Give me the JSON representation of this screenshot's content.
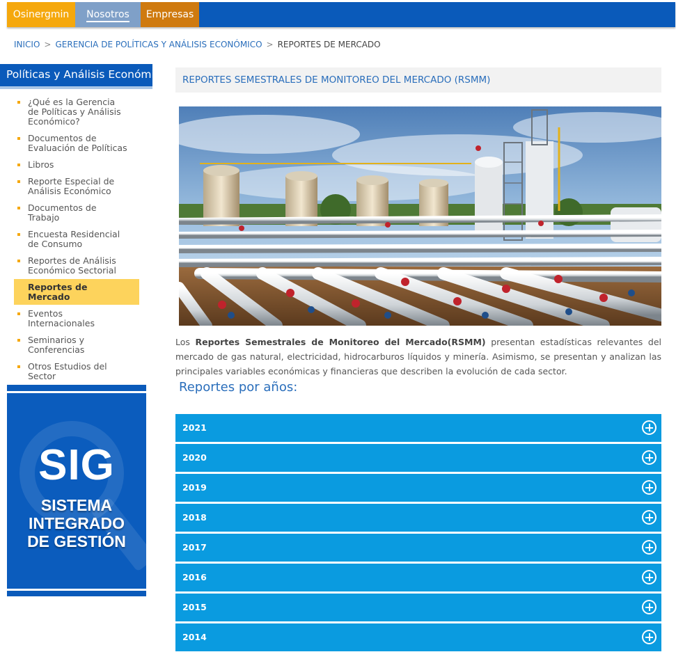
{
  "topnav": {
    "tabs": [
      "Osinergmin",
      "Nosotros",
      "Empresas"
    ],
    "colors": {
      "osinergmin": "#f5a80d",
      "nosotros": "#7fa0c8",
      "empresas": "#cf7a0f",
      "bar": "#0a5aba"
    }
  },
  "breadcrumb": {
    "items": [
      "INICIO",
      "GERENCIA DE POLÍTICAS Y ANÁLISIS ECONÓMICO",
      "REPORTES DE MERCADO"
    ],
    "separator": ">"
  },
  "sidebar": {
    "title": "Políticas y Análisis Económico",
    "items": [
      {
        "label": "¿Qué es la Gerencia de Políticas y Análisis Económico?",
        "lines": [
          "¿Qué es la Gerencia",
          "de Políticas y Análisis",
          "Económico?"
        ]
      },
      {
        "label": "Documentos de Evaluación de Políticas",
        "lines": [
          "Documentos de",
          "Evaluación de Políticas"
        ]
      },
      {
        "label": "Libros",
        "lines": [
          "Libros"
        ]
      },
      {
        "label": "Reporte Especial de Análisis Económico",
        "lines": [
          "Reporte Especial de",
          "Análisis Económico"
        ]
      },
      {
        "label": "Documentos de Trabajo",
        "lines": [
          "Documentos de",
          "Trabajo"
        ]
      },
      {
        "label": "Encuesta Residencial de Consumo",
        "lines": [
          "Encuesta Residencial",
          "de Consumo"
        ]
      },
      {
        "label": "Reportes de Análisis Económico Sectorial",
        "lines": [
          "Reportes de Análisis",
          "Económico Sectorial"
        ]
      },
      {
        "label": "Reportes de Mercado",
        "lines": [
          "Reportes de",
          "Mercado"
        ],
        "active": true
      },
      {
        "label": "Eventos Internacionales",
        "lines": [
          "Eventos",
          "Internacionales"
        ]
      },
      {
        "label": "Seminarios y Conferencias",
        "lines": [
          "Seminarios y",
          "Conferencias"
        ]
      },
      {
        "label": "Otros Estudios del Sector",
        "lines": [
          "Otros Estudios del",
          "Sector"
        ]
      }
    ],
    "banner": {
      "big": "SIG",
      "lines": [
        "SISTEMA",
        "INTEGRADO",
        "DE GESTIÓN"
      ]
    }
  },
  "main": {
    "header": "REPORTES SEMESTRALES DE MONITOREO DEL MERCADO (RSMM)",
    "hero_image": "industrial-gas-pipeline-photo",
    "desc_prefix": "Los ",
    "desc_bold": "Reportes Semestrales de Monitoreo del Mercado(RSMM)",
    "desc_rest": " presentan estadísticas relevantes del mercado de gas natural, electricidad, hidrocarburos líquidos y minería. Asimismo, se presentan y analizan las principales variables económicas y financieras que describen la evolución de cada sector.",
    "years_title": "Reportes por años:",
    "years": [
      "2021",
      "2020",
      "2019",
      "2018",
      "2017",
      "2016",
      "2015",
      "2014"
    ],
    "accordion_color": "#0a9be0"
  }
}
